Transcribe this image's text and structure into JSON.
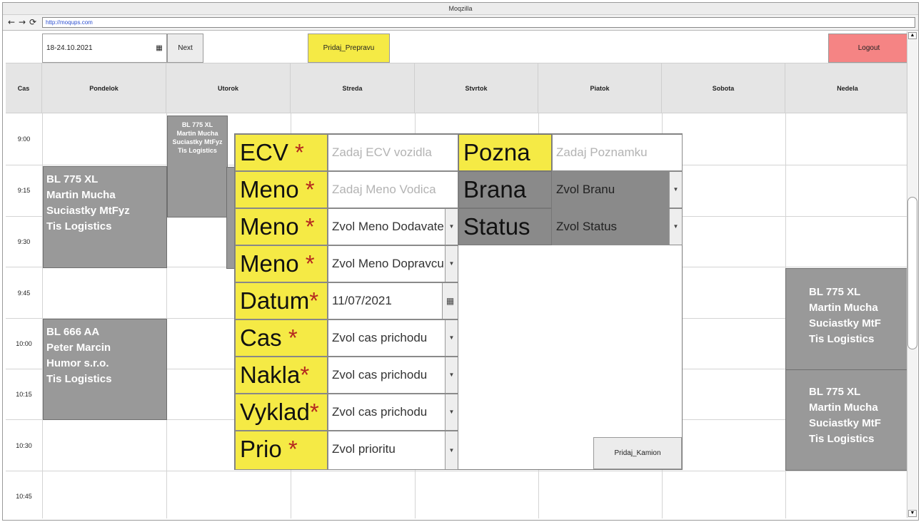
{
  "window": {
    "title": "Moqzilla",
    "url": "http://moqups.com"
  },
  "toolbar": {
    "date_range": "18-24.10.2021",
    "next_label": "Next",
    "add_transport_label": "Pridaj_Prepravu",
    "logout_label": "Logout"
  },
  "schedule": {
    "columns": [
      "Cas",
      "Pondelok",
      "Utorok",
      "Streda",
      "Stvrtok",
      "Piatok",
      "Sobota",
      "Nedela"
    ],
    "times": [
      "9:00",
      "9:15",
      "9:30",
      "9:45",
      "10:00",
      "10:15",
      "10:30",
      "10:45"
    ],
    "events": [
      {
        "lines": [
          "BL 775 XL",
          "Martin Mucha",
          "Suciastky MtFyz",
          "Tis Logistics"
        ]
      },
      {
        "lines": [
          "BL 775 XL",
          "Martin Mucha",
          "Suciastky MtFyz",
          "Tis Logistics"
        ]
      },
      {
        "lines": [
          "BL 666 AA",
          "Peter Marcin",
          "Humor s.r.o.",
          "Tis Logistics"
        ]
      },
      {
        "lines": [
          "BL 775 XL",
          "Martin Mucha",
          "Suciastky MtF",
          "Tis Logistics"
        ]
      },
      {
        "lines": [
          "BL 775 XL",
          "Martin Mucha",
          "Suciastky MtF",
          "Tis Logistics"
        ]
      }
    ]
  },
  "form": {
    "required_mark": "*",
    "rows": [
      {
        "label": "ECV",
        "value": "Zadaj ECV vozidla"
      },
      {
        "label": "Meno",
        "value": "Zadaj Meno Vodica"
      },
      {
        "label": "Meno",
        "value": "Zvol Meno Dodavatela"
      },
      {
        "label": "Meno",
        "value": "Zvol Meno Dopravcu"
      },
      {
        "label": "Datum",
        "value": "11/07/2021"
      },
      {
        "label": "Cas",
        "value": "Zvol cas prichodu"
      },
      {
        "label": "Nakla",
        "value": "Zvol cas prichodu"
      },
      {
        "label": "Vyklad",
        "value": "Zvol cas prichodu"
      },
      {
        "label": "Prio",
        "value": "Zvol prioritu"
      }
    ],
    "right": [
      {
        "label": "Pozna",
        "value": "Zadaj Poznamku"
      },
      {
        "label": "Brana",
        "value": "Zvol Branu"
      },
      {
        "label": "Status",
        "value": "Zvol Status"
      }
    ],
    "add_truck_label": "Pridaj_Kamion"
  }
}
